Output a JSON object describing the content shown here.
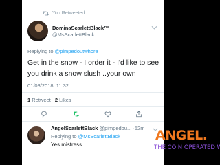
{
  "header": {
    "retweeted_label": "You Retweeted"
  },
  "tweet": {
    "display_name": "DominaScarlettBlack™",
    "handle": "@MsScarlettBlack",
    "replying_prefix": "Replying to ",
    "replying_to": "@pimpedoutwhore",
    "body": "Get in the snow - I order it - I'd like to see you drink a snow slush ..your own",
    "timestamp": "01/03/2018, 11:32",
    "retweet_count": "1",
    "retweet_label": "Retweet",
    "like_count": "2",
    "like_label": "Likes"
  },
  "reply": {
    "display_name": "AngelScarlettBlack",
    "handle": "@pimpedou...",
    "age": "·52m",
    "replying_prefix": "Replying to ",
    "replying_to": "@MsScarlettBlack",
    "body": "Yes mistress"
  },
  "watermark": {
    "line1": "ANGEL.",
    "line2": "THE COIN OPERATED W"
  },
  "colors": {
    "accent": "#1da1f2",
    "muted": "#657786",
    "retweet_green": "#17bf63",
    "watermark_orange": "#f0781e",
    "watermark_purple": "#8a4fd8"
  },
  "icons": [
    "retweet-icon",
    "chevron-down-icon",
    "reply-icon",
    "retweet-action-icon",
    "like-icon",
    "share-icon"
  ]
}
